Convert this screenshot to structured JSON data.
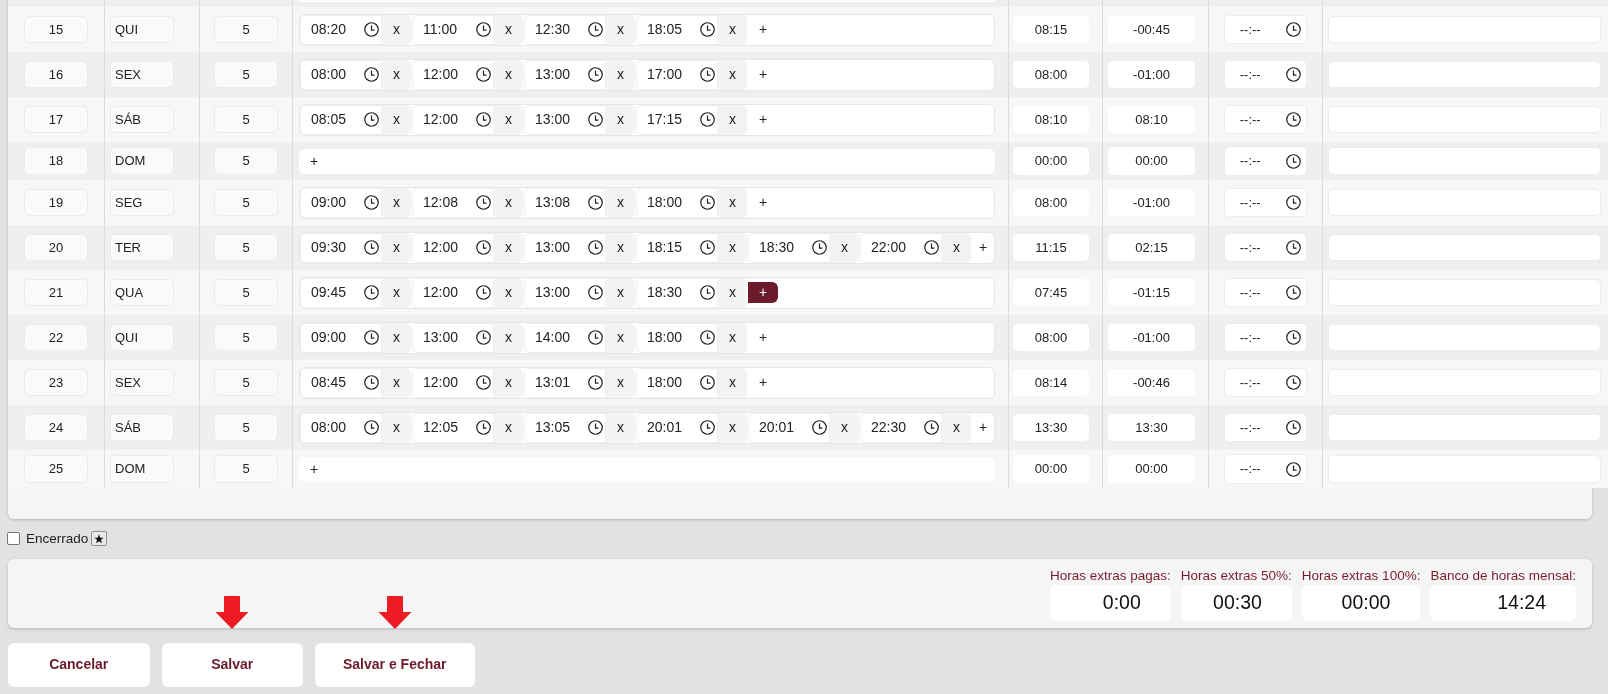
{
  "table": {
    "rows": [
      {
        "day": "15",
        "weekday": "QUI",
        "column_3": "5",
        "times": [
          {
            "value": "08:20",
            "remove": "x"
          },
          {
            "value": "11:00",
            "remove": "x"
          },
          {
            "value": "12:30",
            "remove": "x"
          },
          {
            "value": "18:05",
            "remove": "x"
          }
        ],
        "add": {
          "label": "+",
          "hovered": false
        },
        "column_5": "08:15",
        "column_6": "-00:45",
        "column_7": {
          "placeholder": "--:--"
        }
      },
      {
        "day": "16",
        "weekday": "SEX",
        "column_3": "5",
        "times": [
          {
            "value": "08:00",
            "remove": "x"
          },
          {
            "value": "12:00",
            "remove": "x"
          },
          {
            "value": "13:00",
            "remove": "x"
          },
          {
            "value": "17:00",
            "remove": "x"
          }
        ],
        "add": {
          "label": "+",
          "hovered": false
        },
        "column_5": "08:00",
        "column_6": "-01:00",
        "column_7": {
          "placeholder": "--:--"
        }
      },
      {
        "day": "17",
        "weekday": "SÁB",
        "column_3": "5",
        "times": [
          {
            "value": "08:05",
            "remove": "x"
          },
          {
            "value": "12:00",
            "remove": "x"
          },
          {
            "value": "13:00",
            "remove": "x"
          },
          {
            "value": "17:15",
            "remove": "x"
          }
        ],
        "add": {
          "label": "+",
          "hovered": false
        },
        "column_5": "08:10",
        "column_6": "08:10",
        "column_7": {
          "placeholder": "--:--"
        }
      },
      {
        "day": "18",
        "weekday": "DOM",
        "column_3": "5",
        "times": [],
        "add": {
          "label": "+",
          "hovered": false
        },
        "column_5": "00:00",
        "column_6": "00:00",
        "column_7": {
          "placeholder": "--:--"
        }
      },
      {
        "day": "19",
        "weekday": "SEG",
        "column_3": "5",
        "times": [
          {
            "value": "09:00",
            "remove": "x"
          },
          {
            "value": "12:08",
            "remove": "x"
          },
          {
            "value": "13:08",
            "remove": "x"
          },
          {
            "value": "18:00",
            "remove": "x"
          }
        ],
        "add": {
          "label": "+",
          "hovered": false
        },
        "column_5": "08:00",
        "column_6": "-01:00",
        "column_7": {
          "placeholder": "--:--"
        }
      },
      {
        "day": "20",
        "weekday": "TER",
        "column_3": "5",
        "times": [
          {
            "value": "09:30",
            "remove": "x"
          },
          {
            "value": "12:00",
            "remove": "x"
          },
          {
            "value": "13:00",
            "remove": "x"
          },
          {
            "value": "18:15",
            "remove": "x"
          },
          {
            "value": "18:30",
            "remove": "x"
          },
          {
            "value": "22:00",
            "remove": "x"
          }
        ],
        "add": {
          "label": "+",
          "hovered": false
        },
        "column_5": "11:15",
        "column_6": "02:15",
        "column_7": {
          "placeholder": "--:--"
        }
      },
      {
        "day": "21",
        "weekday": "QUA",
        "column_3": "5",
        "times": [
          {
            "value": "09:45",
            "remove": "x"
          },
          {
            "value": "12:00",
            "remove": "x"
          },
          {
            "value": "13:00",
            "remove": "x"
          },
          {
            "value": "18:30",
            "remove": "x"
          }
        ],
        "add": {
          "label": "+",
          "hovered": true
        },
        "column_5": "07:45",
        "column_6": "-01:15",
        "column_7": {
          "placeholder": "--:--"
        }
      },
      {
        "day": "22",
        "weekday": "QUI",
        "column_3": "5",
        "times": [
          {
            "value": "09:00",
            "remove": "x"
          },
          {
            "value": "13:00",
            "remove": "x"
          },
          {
            "value": "14:00",
            "remove": "x"
          },
          {
            "value": "18:00",
            "remove": "x"
          }
        ],
        "add": {
          "label": "+",
          "hovered": false
        },
        "column_5": "08:00",
        "column_6": "-01:00",
        "column_7": {
          "placeholder": "--:--"
        }
      },
      {
        "day": "23",
        "weekday": "SEX",
        "column_3": "5",
        "times": [
          {
            "value": "08:45",
            "remove": "x"
          },
          {
            "value": "12:00",
            "remove": "x"
          },
          {
            "value": "13:01",
            "remove": "x"
          },
          {
            "value": "18:00",
            "remove": "x"
          }
        ],
        "add": {
          "label": "+",
          "hovered": false
        },
        "column_5": "08:14",
        "column_6": "-00:46",
        "column_7": {
          "placeholder": "--:--"
        }
      },
      {
        "day": "24",
        "weekday": "SÁB",
        "column_3": "5",
        "times": [
          {
            "value": "08:00",
            "remove": "x"
          },
          {
            "value": "12:05",
            "remove": "x"
          },
          {
            "value": "13:05",
            "remove": "x"
          },
          {
            "value": "20:01",
            "remove": "x"
          },
          {
            "value": "20:01",
            "remove": "x"
          },
          {
            "value": "22:30",
            "remove": "x"
          }
        ],
        "add": {
          "label": "+",
          "hovered": false
        },
        "column_5": "13:30",
        "column_6": "13:30",
        "column_7": {
          "placeholder": "--:--"
        }
      },
      {
        "day": "25",
        "weekday": "DOM",
        "column_3": "5",
        "times": [],
        "add": {
          "label": "+",
          "hovered": false
        },
        "column_5": "00:00",
        "column_6": "00:00",
        "column_7": {
          "placeholder": "--:--"
        }
      }
    ]
  },
  "closed": {
    "label": "Encerrado",
    "checked": false
  },
  "summary": [
    {
      "label": "Horas extras pagas:",
      "value": "0:00"
    },
    {
      "label": "Horas extras 50%:",
      "value": "00:30"
    },
    {
      "label": "Horas extras 100%:",
      "value": "00:00"
    },
    {
      "label": "Banco de horas mensal:",
      "value": "14:24"
    }
  ],
  "buttons": [
    {
      "label": "Cancelar",
      "pointed": false
    },
    {
      "label": "Salvar",
      "pointed": true
    },
    {
      "label": "Salvar e Fechar",
      "pointed": true
    }
  ]
}
